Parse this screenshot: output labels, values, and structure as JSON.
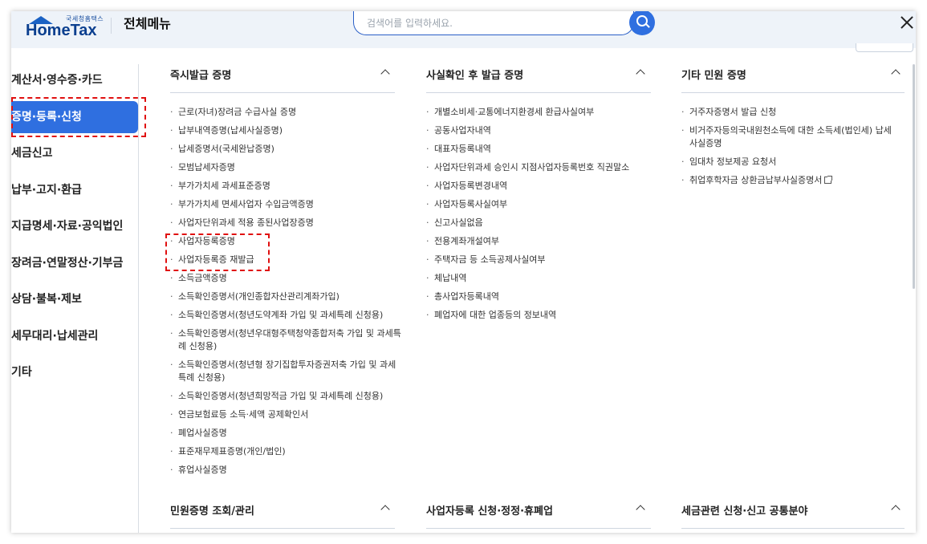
{
  "header": {
    "logo_small": "국세청홈택스",
    "logo_text": "HomeTax",
    "menu_title": "전체메뉴",
    "search_placeholder": "검색어를 입력하세요."
  },
  "sidebar": {
    "items": [
      {
        "label": "계산서·영수증·카드"
      },
      {
        "label": "증명·등록·신청",
        "active": true
      },
      {
        "label": "세금신고"
      },
      {
        "label": "납부·고지·환급"
      },
      {
        "label": "지급명세·자료·공익법인"
      },
      {
        "label": "장려금·연말정산·기부금"
      },
      {
        "label": "상담·불복·제보"
      },
      {
        "label": "세무대리·납세관리"
      },
      {
        "label": "기타"
      }
    ]
  },
  "sections": {
    "instant": {
      "title": "즉시발급 증명",
      "items": [
        "근로(자녀)장려금 수급사실 증명",
        "납부내역증명(납세사실증명)",
        "납세증명서(국세완납증명)",
        "모범납세자증명",
        "부가가치세 과세표준증명",
        "부가가치세 면세사업자 수입금액증명",
        "사업자단위과세 적용 종된사업장증명",
        "사업자등록증명",
        "사업자등록증 재발급",
        "소득금액증명",
        "소득확인증명서(개인종합자산관리계좌가입)",
        "소득확인증명서(청년도약계좌 가입 및 과세특례 신청용)",
        "소득확인증명서(청년우대형주택청약종합저축 가입 및 과세특례 신청용)",
        "소득확인증명서(청년형 장기집합투자증권저축 가입 및 과세특례 신청용)",
        "소득확인증명서(청년희망적금 가입 및 과세특례 신청용)",
        "연금보험료등 소득·세액 공제확인서",
        "폐업사실증명",
        "표준재무제표증명(개인/법인)",
        "휴업사실증명"
      ]
    },
    "after_check": {
      "title": "사실확인 후 발급 증명",
      "items": [
        "개별소비세·교통에너지환경세 환급사실여부",
        "공동사업자내역",
        "대표자등록내역",
        "사업자단위과세 승인시 지점사업자등록번호 직권말소",
        "사업자등록변경내역",
        "사업자등록사실여부",
        "신고사실없음",
        "전용계좌개설여부",
        "주택자금 등 소득공제사실여부",
        "체납내역",
        "총사업자등록내역",
        "폐업자에 대한 업종등의 정보내역"
      ]
    },
    "other": {
      "title": "기타 민원 증명",
      "items": [
        "거주자증명서 발급 신청",
        "비거주자등의국내원천소득에 대한 소득세(법인세) 납세사실증명",
        "임대차 정보제공 요청서",
        "취업후학자금 상환금납부사실증명서"
      ]
    },
    "bottom": [
      {
        "title": "민원증명 조회/관리"
      },
      {
        "title": "사업자등록 신청·정정·휴폐업"
      },
      {
        "title": "세금관련 신청·신고 공통분야"
      }
    ]
  },
  "colors": {
    "accent": "#2f6fe0",
    "highlight_border": "#e01010",
    "topbar_bg": "#eef3f9"
  },
  "icons": {
    "search": "search-icon",
    "close": "close-icon",
    "collapse": "chevron-up-icon",
    "external": "external-link-icon"
  }
}
